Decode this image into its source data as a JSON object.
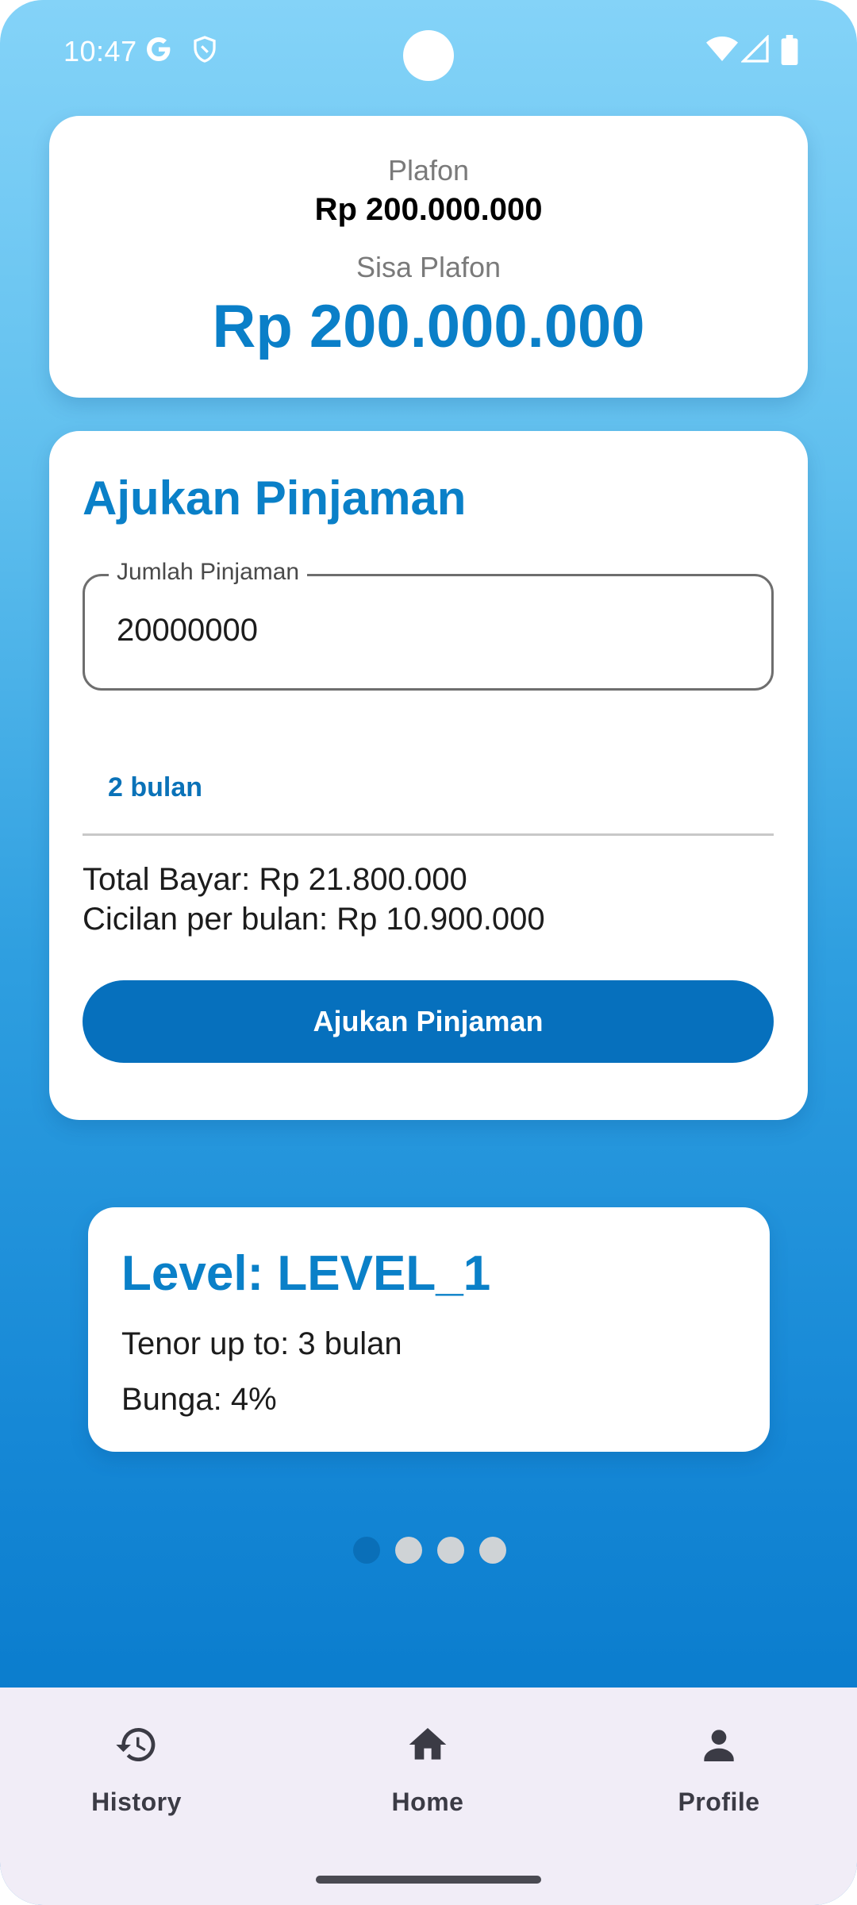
{
  "status_bar": {
    "time": "10:47",
    "icons": [
      "google-icon",
      "shield-icon",
      "wifi-icon",
      "signal-icon",
      "battery-icon"
    ]
  },
  "plafon_card": {
    "plafon_label": "Plafon",
    "plafon_value": "Rp 200.000.000",
    "sisa_label": "Sisa Plafon",
    "sisa_value": "Rp 200.000.000"
  },
  "loan_form": {
    "title": "Ajukan Pinjaman",
    "amount_label": "Jumlah Pinjaman",
    "amount_value": "20000000",
    "tenor_value": "2 bulan",
    "total_bayar": "Total Bayar: Rp 21.800.000",
    "cicilan": "Cicilan per bulan: Rp 10.900.000",
    "submit_label": "Ajukan Pinjaman"
  },
  "level_card": {
    "title": "Level: LEVEL_1",
    "tenor": "Tenor up to: 3 bulan",
    "bunga": "Bunga: 4%"
  },
  "pager": {
    "total": 4,
    "active_index": 0
  },
  "bottom_nav": {
    "items": [
      {
        "label": "History",
        "icon": "history-icon"
      },
      {
        "label": "Home",
        "icon": "home-icon"
      },
      {
        "label": "Profile",
        "icon": "profile-icon"
      }
    ]
  },
  "colors": {
    "accent": "#0a80c8",
    "button": "#0670bd",
    "nav_background": "#f1edf7"
  }
}
